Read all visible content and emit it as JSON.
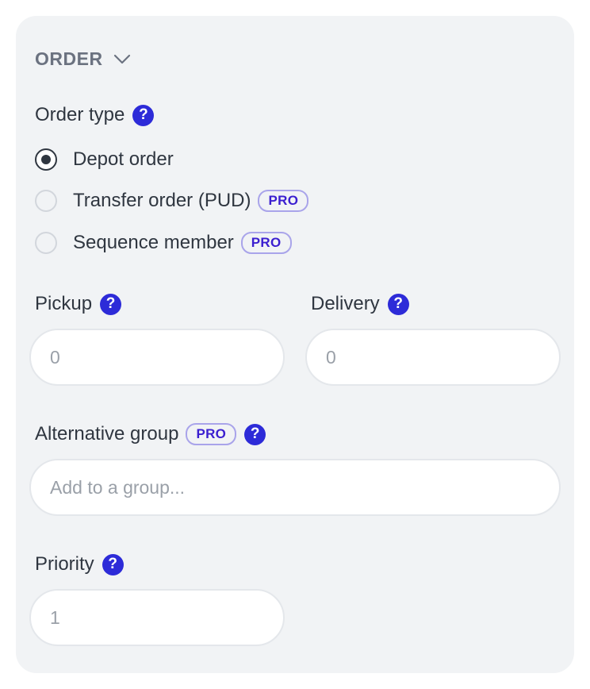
{
  "section": {
    "title": "ORDER"
  },
  "order_type": {
    "label": "Order type",
    "help": "?",
    "options": [
      {
        "label": "Depot order",
        "selected": true,
        "pro": ""
      },
      {
        "label": "Transfer order (PUD)",
        "selected": false,
        "pro": "PRO"
      },
      {
        "label": "Sequence member",
        "selected": false,
        "pro": "PRO"
      }
    ]
  },
  "pickup": {
    "label": "Pickup",
    "help": "?",
    "placeholder": "0"
  },
  "delivery": {
    "label": "Delivery",
    "help": "?",
    "placeholder": "0"
  },
  "alternative_group": {
    "label": "Alternative group",
    "pro": "PRO",
    "help": "?",
    "placeholder": "Add to a group..."
  },
  "priority": {
    "label": "Priority",
    "help": "?",
    "placeholder": "1"
  },
  "colors": {
    "panel_bg": "#f1f3f5",
    "accent": "#2d2bd8",
    "pro_text": "#3b1fd0",
    "pro_border": "#a9a4ea",
    "text": "#2f3640",
    "muted": "#6b7280"
  }
}
